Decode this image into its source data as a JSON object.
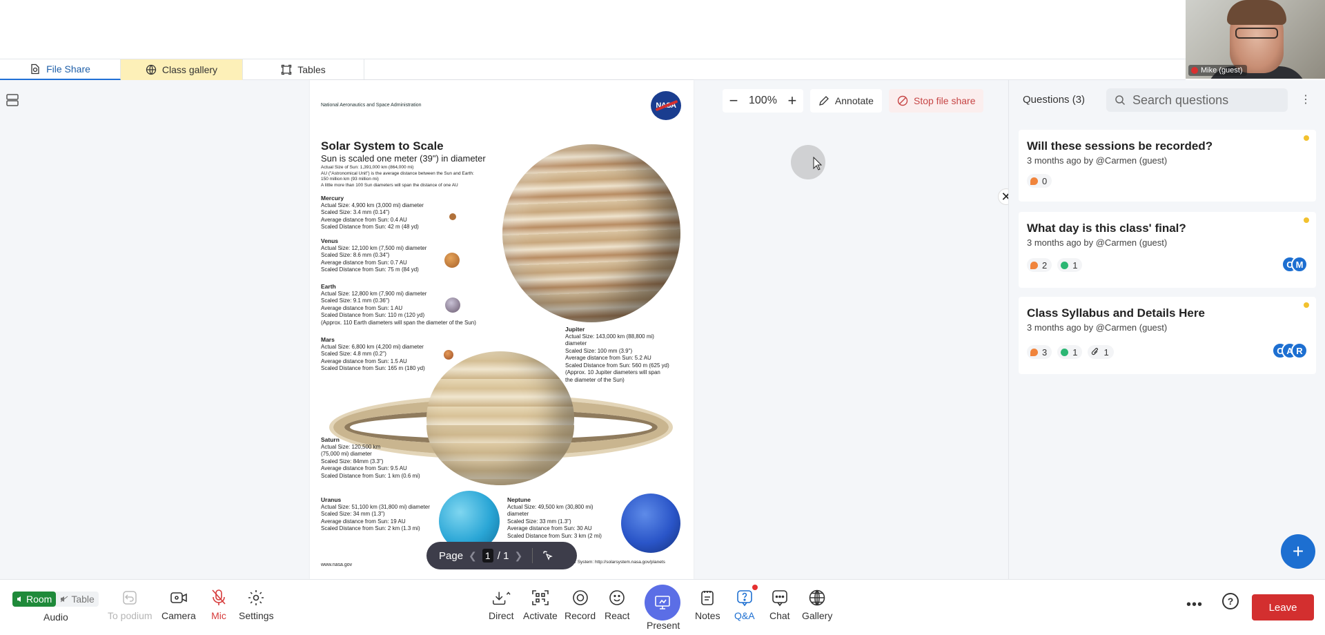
{
  "tabs": [
    {
      "label": "File Share",
      "icon": "file-share-icon"
    },
    {
      "label": "Class gallery",
      "icon": "globe-icon"
    },
    {
      "label": "Tables",
      "icon": "tables-icon"
    }
  ],
  "video": {
    "name": "Mike (guest)"
  },
  "document": {
    "agency": "National Aeronautics and Space Administration",
    "logo": "NASA",
    "title": "Solar System to Scale",
    "subtitle": "Sun is scaled one meter (39\") in diameter",
    "intro": [
      "Actual Size of Sun: 1,391,000 km (864,000 mi)",
      "AU (\"Astronomical Unit\") is the average distance between the Sun and Earth:",
      "150 million km (93 million mi)",
      "A little more than 100 Sun diameters will span the distance of one AU"
    ],
    "planets": [
      {
        "name": "Mercury",
        "lines": [
          "Actual Size: 4,900 km (3,000 mi) diameter",
          "Scaled Size: 3.4 mm (0.14\")",
          "Average distance from Sun: 0.4 AU",
          "Scaled Distance from Sun: 42 m (48 yd)"
        ]
      },
      {
        "name": "Venus",
        "lines": [
          "Actual Size: 12,100 km (7,500 mi) diameter",
          "Scaled Size: 8.6 mm (0.34\")",
          "Average distance from Sun: 0.7 AU",
          "Scaled Distance from Sun: 75 m (84 yd)"
        ]
      },
      {
        "name": "Earth",
        "lines": [
          "Actual Size: 12,800 km (7,900 mi) diameter",
          "Scaled Size: 9.1 mm (0.36\")",
          "Average distance from Sun: 1 AU",
          "Scaled Distance from Sun: 110 m (120 yd)",
          "(Approx. 110 Earth diameters will span the diameter of the Sun)"
        ]
      },
      {
        "name": "Mars",
        "lines": [
          "Actual Size: 6,800 km (4,200 mi) diameter",
          "Scaled Size: 4.8 mm (0.2\")",
          "Average distance from Sun: 1.5 AU",
          "Scaled Distance from Sun: 165 m (180 yd)"
        ]
      },
      {
        "name": "Jupiter",
        "lines": [
          "Actual Size: 143,000 km (88,800 mi)",
          "diameter",
          "Scaled Size: 100 mm (3.9\")",
          "Average distance from Sun: 5.2 AU",
          "Scaled Distance from Sun: 560 m (625 yd)",
          "(Approx. 10 Jupiter diameters will span",
          "the diameter of the Sun)"
        ]
      },
      {
        "name": "Saturn",
        "lines": [
          "Actual Size: 120,500 km",
          "(75,000 mi) diameter",
          "Scaled Size: 84mm (3.3\")",
          "Average distance from Sun: 9.5 AU",
          "Scaled Distance from Sun: 1 km (0.6 mi)"
        ]
      },
      {
        "name": "Uranus",
        "lines": [
          "Actual Size: 51,100 km (31,800 mi) diameter",
          "Scaled Size: 34 mm (1.3\")",
          "Average distance from Sun: 19 AU",
          "Scaled Distance from Sun: 2 km (1.3 mi)"
        ]
      },
      {
        "name": "Neptune",
        "lines": [
          "Actual Size: 49,500 km (30,800 mi)",
          "diameter",
          "Scaled Size: 33 mm (1.3\")",
          "Average distance from Sun: 30 AU",
          "Scaled Distance from Sun: 3 km (2 mi)"
        ]
      }
    ],
    "footer_left": "www.nasa.gov",
    "footer_right": "Discover the Worlds of Our Solar System: http://solarsystem.nasa.gov/planets"
  },
  "pagenav": {
    "label": "Page",
    "current": "1",
    "total": "/ 1"
  },
  "doc_toolbar": {
    "zoom": "100%",
    "annotate": "Annotate",
    "stop_share": "Stop file share"
  },
  "qa": {
    "title": "Questions (3)",
    "search_placeholder": "Search questions",
    "questions": [
      {
        "title": "Will these sessions be recorded?",
        "meta": "3 months ago by @Carmen (guest)",
        "comments": "0"
      },
      {
        "title": "What day is this class' final?",
        "meta": "3 months ago by @Carmen (guest)",
        "comments": "2",
        "answers": "1",
        "avatars": [
          "C",
          "M"
        ]
      },
      {
        "title": "Class Syllabus and Details Here",
        "meta": "3 months ago by @Carmen (guest)",
        "comments": "3",
        "answers": "1",
        "attachments": "1",
        "avatars": [
          "C",
          "A",
          "R"
        ]
      }
    ]
  },
  "bottombar": {
    "room": "Room",
    "table": "Table",
    "audio": "Audio",
    "buttons": {
      "to_podium": "To podium",
      "camera": "Camera",
      "mic": "Mic",
      "settings": "Settings",
      "direct": "Direct",
      "activate": "Activate",
      "record": "Record",
      "react": "React",
      "present": "Present",
      "notes": "Notes",
      "qa": "Q&A",
      "chat": "Chat",
      "gallery": "Gallery"
    },
    "leave": "Leave"
  },
  "colors": {
    "accent": "#1d6fd1",
    "leave": "#d32f2f",
    "room_on": "#1f8a3a",
    "present": "#5b6ee6",
    "gallery_tab": "#fdf0b8"
  }
}
